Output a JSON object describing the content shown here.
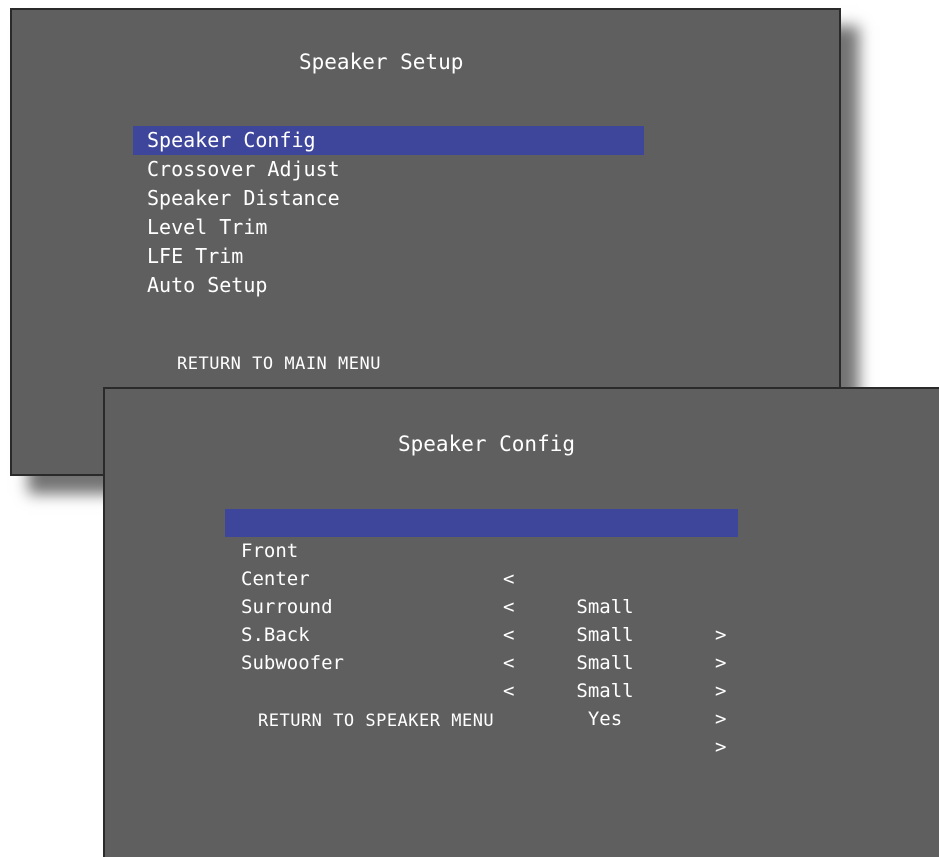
{
  "speaker_setup": {
    "title": "Speaker Setup",
    "items": [
      {
        "label": "Speaker Config",
        "selected": true
      },
      {
        "label": "Crossover Adjust",
        "selected": false
      },
      {
        "label": "Speaker Distance",
        "selected": false
      },
      {
        "label": "Level Trim",
        "selected": false
      },
      {
        "label": "LFE Trim",
        "selected": false
      },
      {
        "label": "Auto Setup",
        "selected": false
      }
    ],
    "return_label": "RETURN TO MAIN MENU"
  },
  "speaker_config": {
    "title": "Speaker Config",
    "arrow_left": "<",
    "arrow_right": ">",
    "rows": [
      {
        "label": "Front",
        "value": "Small",
        "selected": true
      },
      {
        "label": "Center",
        "value": "Small",
        "selected": false
      },
      {
        "label": "Surround",
        "value": "Small",
        "selected": false
      },
      {
        "label": "S.Back",
        "value": "Small",
        "selected": false
      },
      {
        "label": "Subwoofer",
        "value": "Yes",
        "selected": false
      }
    ],
    "return_label": "RETURN TO SPEAKER MENU"
  },
  "colors": {
    "panel_background": "#5f5f5f",
    "selection_highlight": "#3e469b",
    "text": "#ffffff"
  }
}
